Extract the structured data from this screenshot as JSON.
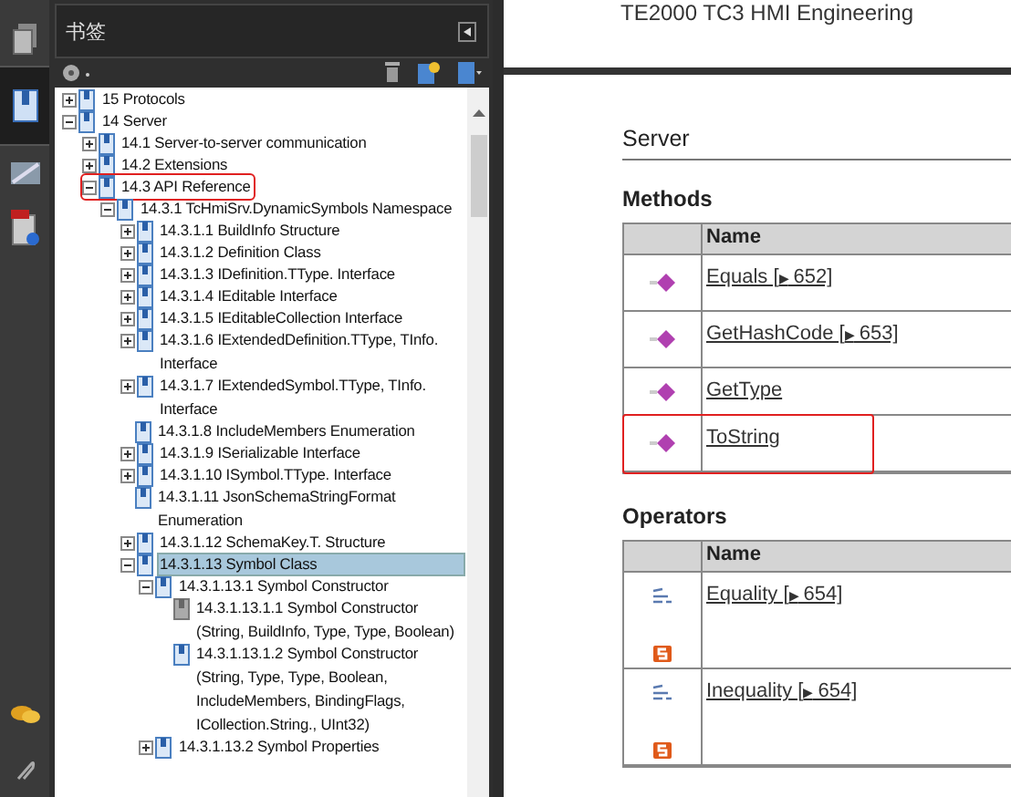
{
  "tool_strip": [
    {
      "kind": "pages",
      "selected": false
    },
    {
      "kind": "bookmarks",
      "selected": true
    },
    {
      "kind": "signatures",
      "selected": false
    },
    {
      "kind": "attachments",
      "selected": false
    }
  ],
  "tool_strip_bottom": [
    {
      "kind": "comments",
      "selected": false
    },
    {
      "kind": "clip",
      "selected": false
    }
  ],
  "panel": {
    "title": "书签"
  },
  "tree": [
    {
      "label": "15 Protocols",
      "kind": "branch",
      "expanded": false,
      "selected": false,
      "outlined": false
    },
    {
      "label": "14 Server",
      "kind": "branch",
      "expanded": true,
      "selected": false,
      "outlined": false,
      "children": [
        {
          "label": "14.1 Server-to-server communication",
          "kind": "branch",
          "expanded": false,
          "selected": false,
          "outlined": false
        },
        {
          "label": "14.2 Extensions",
          "kind": "branch",
          "expanded": false,
          "selected": false,
          "outlined": false
        },
        {
          "label": "14.3 API Reference",
          "kind": "branch",
          "expanded": true,
          "selected": false,
          "outlined": true,
          "children": [
            {
              "label": "14.3.1 TcHmiSrv.DynamicSymbols Namespace",
              "kind": "branch",
              "expanded": true,
              "selected": false,
              "outlined": false,
              "children": [
                {
                  "label": "14.3.1.1 BuildInfo Structure",
                  "kind": "branch",
                  "expanded": false,
                  "selected": false,
                  "outlined": false
                },
                {
                  "label": "14.3.1.2 Definition Class",
                  "kind": "branch",
                  "expanded": false,
                  "selected": false,
                  "outlined": false
                },
                {
                  "label": "14.3.1.3 IDefinition.TType. Interface",
                  "kind": "branch",
                  "expanded": false,
                  "selected": false,
                  "outlined": false
                },
                {
                  "label": "14.3.1.4 IEditable Interface",
                  "kind": "branch",
                  "expanded": false,
                  "selected": false,
                  "outlined": false
                },
                {
                  "label": "14.3.1.5 IEditableCollection Interface",
                  "kind": "branch",
                  "expanded": false,
                  "selected": false,
                  "outlined": false
                },
                {
                  "label": "14.3.1.6 IExtendedDefinition.TType, TInfo. Interface",
                  "kind": "branch",
                  "expanded": false,
                  "selected": false,
                  "outlined": false
                },
                {
                  "label": "14.3.1.7 IExtendedSymbol.TType, TInfo. Interface",
                  "kind": "branch",
                  "expanded": false,
                  "selected": false,
                  "outlined": false
                },
                {
                  "label": "14.3.1.8 IncludeMembers Enumeration",
                  "kind": "leaf",
                  "selected": false,
                  "outlined": false
                },
                {
                  "label": "14.3.1.9 ISerializable Interface",
                  "kind": "branch",
                  "expanded": false,
                  "selected": false,
                  "outlined": false
                },
                {
                  "label": "14.3.1.10 ISymbol.TType. Interface",
                  "kind": "branch",
                  "expanded": false,
                  "selected": false,
                  "outlined": false
                },
                {
                  "label": "14.3.1.11 JsonSchemaStringFormat Enumeration",
                  "kind": "leaf",
                  "selected": false,
                  "outlined": false
                },
                {
                  "label": "14.3.1.12 SchemaKey.T. Structure",
                  "kind": "branch",
                  "expanded": false,
                  "selected": false,
                  "outlined": false
                },
                {
                  "label": "14.3.1.13 Symbol Class",
                  "kind": "branch",
                  "expanded": true,
                  "selected": true,
                  "outlined": false,
                  "children": [
                    {
                      "label": "14.3.1.13.1 Symbol Constructor",
                      "kind": "branch",
                      "expanded": true,
                      "selected": false,
                      "outlined": false,
                      "children": [
                        {
                          "label": "14.3.1.13.1.1 Symbol Constructor (String, BuildInfo, Type, Type, Boolean)",
                          "kind": "dimmed",
                          "selected": false,
                          "outlined": false
                        },
                        {
                          "label": "14.3.1.13.1.2 Symbol Constructor (String, Type, Type, Boolean, IncludeMembers, BindingFlags, ICollection.String., UInt32)",
                          "kind": "leaf",
                          "selected": false,
                          "outlined": false
                        }
                      ]
                    },
                    {
                      "label": "14.3.1.13.2 Symbol Properties",
                      "kind": "branch",
                      "expanded": false,
                      "selected": false,
                      "outlined": false
                    }
                  ]
                }
              ]
            }
          ]
        }
      ]
    }
  ],
  "document": {
    "running_header": "TE2000 TC3 HMI Engineering",
    "heading": "Server",
    "sections": [
      {
        "title": "Methods",
        "column": "Name",
        "rows": [
          {
            "kind": "method",
            "name": "Equals [",
            "arrow": "▶",
            "page": "652]",
            "outlined": false
          },
          {
            "kind": "method",
            "name": "GetHashCode [",
            "arrow": "▶",
            "page": "653]",
            "outlined": false
          },
          {
            "kind": "method",
            "name": "GetType",
            "outlined": false
          },
          {
            "kind": "method",
            "name": "ToString",
            "outlined": true
          }
        ]
      },
      {
        "title": "Operators",
        "column": "Name",
        "rows": [
          {
            "kind": "operator",
            "name": "Equality [",
            "arrow": "▶",
            "page": "654]",
            "outlined": false
          },
          {
            "kind": "operator",
            "name": "Inequality [",
            "arrow": "▶",
            "page": "654]",
            "outlined": false
          }
        ]
      }
    ]
  }
}
